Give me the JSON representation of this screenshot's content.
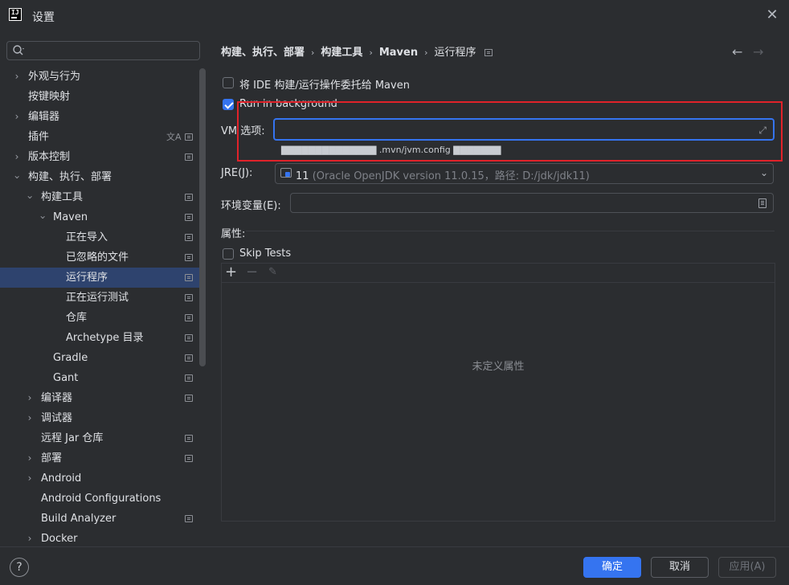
{
  "window": {
    "title": "设置",
    "logo_text": "IJ"
  },
  "search": {
    "value": "",
    "placeholder": ""
  },
  "sidebar": {
    "items": [
      {
        "label": "外观与行为",
        "expanded": false
      },
      {
        "label": "按键映射"
      },
      {
        "label": "编辑器",
        "expanded": false
      },
      {
        "label": "插件"
      },
      {
        "label": "版本控制",
        "expanded": false
      },
      {
        "label": "构建、执行、部署",
        "expanded": true
      },
      {
        "label": "构建工具",
        "expanded": true
      },
      {
        "label": "Maven",
        "expanded": true
      },
      {
        "label": "正在导入"
      },
      {
        "label": "已忽略的文件"
      },
      {
        "label": "运行程序",
        "selected": true
      },
      {
        "label": "正在运行测试"
      },
      {
        "label": "仓库"
      },
      {
        "label": "Archetype 目录"
      },
      {
        "label": "Gradle"
      },
      {
        "label": "Gant"
      },
      {
        "label": "编译器",
        "expanded": false
      },
      {
        "label": "调试器",
        "expanded": false
      },
      {
        "label": "远程 Jar 仓库"
      },
      {
        "label": "部署",
        "expanded": false
      },
      {
        "label": "Android",
        "expanded": false
      },
      {
        "label": "Android Configurations"
      },
      {
        "label": "Build Analyzer"
      },
      {
        "label": "Docker",
        "expanded": false
      }
    ]
  },
  "breadcrumb": {
    "items": [
      "构建、执行、部署",
      "构建工具",
      "Maven",
      "运行程序"
    ],
    "separator": "›"
  },
  "nav": {
    "back": "←",
    "forward": "→"
  },
  "main": {
    "delegate_label": "将 IDE 构建/运行操作委托给 Maven",
    "delegate_checked": false,
    "run_background_label": "Run in background",
    "run_background_checked": true,
    "vm_label": "VM 选项:",
    "vm_value": "",
    "vm_hint": "▇▇▇▇▇▇▇▇▇▇▇▇▇▇ .mvn/jvm.config ▇▇▇▇▇▇▇",
    "jre_label": "JRE(J):",
    "jre_version": "11",
    "jre_detail": "(Oracle OpenJDK version 11.0.15，路径: D:/jdk/jdk11)",
    "env_label": "环境变量(E):",
    "env_value": "",
    "props_label": "属性:",
    "skip_tests_label": "Skip Tests",
    "skip_tests_checked": false,
    "props_empty": "未定义属性"
  },
  "footer": {
    "help": "?",
    "ok": "确定",
    "cancel": "取消",
    "apply": "应用(A)"
  },
  "colors": {
    "background": "#2b2d30",
    "accent": "#3574f0",
    "selection": "#2e436e",
    "highlight_box": "#e0222a"
  }
}
